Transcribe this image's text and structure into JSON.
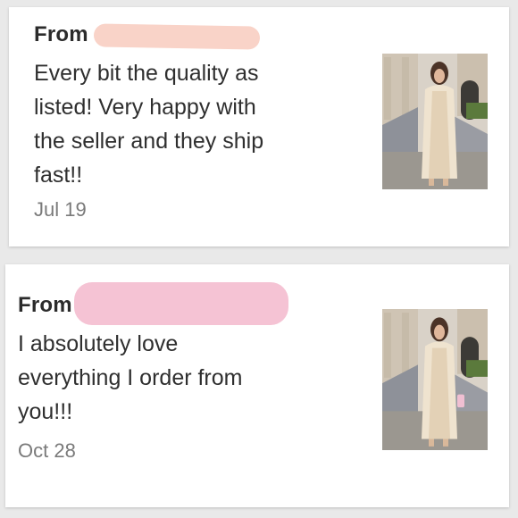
{
  "reviews": [
    {
      "from_label": "From",
      "message": "Every bit the quality as\nlisted! Very happy with\nthe seller and they ship\nfast!!",
      "date": "Jul 19",
      "redaction_color": "#f9d3c8"
    },
    {
      "from_label": "From",
      "message": "I absolutely love\neverything I order from\nyou!!!",
      "date": "Oct 28",
      "redaction_color": "#f5c3d4"
    }
  ],
  "product_photo_icon": "woman-in-long-cream-dress-photo"
}
